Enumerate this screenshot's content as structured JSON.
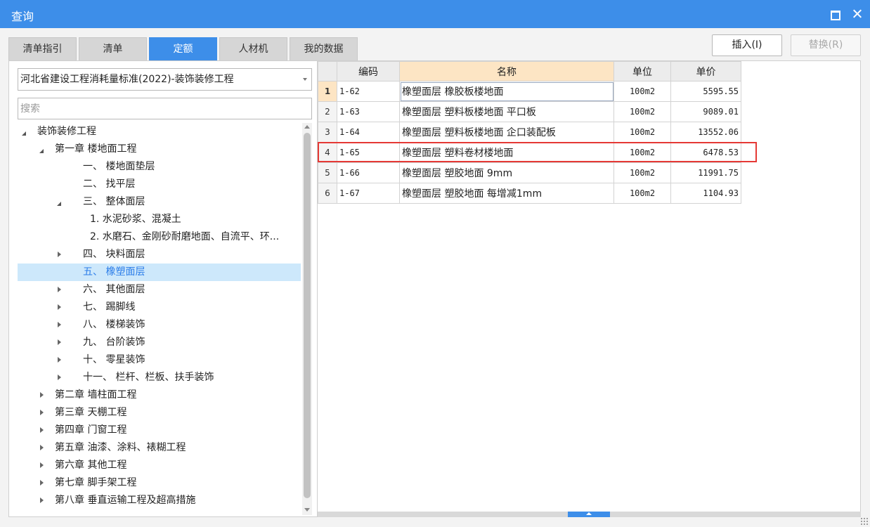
{
  "window": {
    "title": "查询"
  },
  "tabs": [
    "清单指引",
    "清单",
    "定额",
    "人材机",
    "我的数据"
  ],
  "active_tab": "定额",
  "actions": {
    "insert": "插入(I)",
    "replace": "替换(R)"
  },
  "library": {
    "selected": "河北省建设工程消耗量标准(2022)-装饰装修工程"
  },
  "search": {
    "placeholder": "搜索",
    "value": ""
  },
  "tree": [
    {
      "label": "装饰装修工程",
      "level": 0,
      "toggle": "open"
    },
    {
      "label": "第一章 楼地面工程",
      "level": 1,
      "toggle": "open"
    },
    {
      "label": "一、  楼地面垫层",
      "level": 2,
      "toggle": "none"
    },
    {
      "label": "二、  找平层",
      "level": 2,
      "toggle": "none"
    },
    {
      "label": "三、  整体面层",
      "level": 2,
      "toggle": "open"
    },
    {
      "label": "1. 水泥砂浆、混凝土",
      "level": 3,
      "toggle": "none"
    },
    {
      "label": "2. 水磨石、金刚砂耐磨地面、自流平、环...",
      "level": 3,
      "toggle": "none"
    },
    {
      "label": "四、  块料面层",
      "level": 2,
      "toggle": "closed"
    },
    {
      "label": "五、  橡塑面层",
      "level": 2,
      "toggle": "none",
      "selected": true
    },
    {
      "label": "六、  其他面层",
      "level": 2,
      "toggle": "closed"
    },
    {
      "label": "七、  踢脚线",
      "level": 2,
      "toggle": "closed"
    },
    {
      "label": "八、  楼梯装饰",
      "level": 2,
      "toggle": "closed"
    },
    {
      "label": "九、  台阶装饰",
      "level": 2,
      "toggle": "closed"
    },
    {
      "label": "十、  零星装饰",
      "level": 2,
      "toggle": "closed"
    },
    {
      "label": "十一、 栏杆、栏板、扶手装饰",
      "level": 2,
      "toggle": "closed"
    },
    {
      "label": "第二章 墙柱面工程",
      "level": 1,
      "toggle": "closed"
    },
    {
      "label": "第三章 天棚工程",
      "level": 1,
      "toggle": "closed"
    },
    {
      "label": "第四章 门窗工程",
      "level": 1,
      "toggle": "closed"
    },
    {
      "label": "第五章 油漆、涂料、裱糊工程",
      "level": 1,
      "toggle": "closed"
    },
    {
      "label": "第六章 其他工程",
      "level": 1,
      "toggle": "closed"
    },
    {
      "label": "第七章 脚手架工程",
      "level": 1,
      "toggle": "closed"
    },
    {
      "label": "第八章 垂直运输工程及超高措施",
      "level": 1,
      "toggle": "closed"
    }
  ],
  "table": {
    "headers": [
      "",
      "编码",
      "名称",
      "单位",
      "单价"
    ],
    "rows": [
      {
        "idx": "1",
        "code": "1-62",
        "name": "橡塑面层 橡胶板楼地面",
        "unit": "100m2",
        "price": "5595.55"
      },
      {
        "idx": "2",
        "code": "1-63",
        "name": "橡塑面层 塑料板楼地面 平口板",
        "unit": "100m2",
        "price": "9089.01"
      },
      {
        "idx": "3",
        "code": "1-64",
        "name": "橡塑面层 塑料板楼地面 企口装配板",
        "unit": "100m2",
        "price": "13552.06"
      },
      {
        "idx": "4",
        "code": "1-65",
        "name": "橡塑面层 塑料卷材楼地面",
        "unit": "100m2",
        "price": "6478.53"
      },
      {
        "idx": "5",
        "code": "1-66",
        "name": "橡塑面层 塑胶地面 9mm",
        "unit": "100m2",
        "price": "11991.75"
      },
      {
        "idx": "6",
        "code": "1-67",
        "name": "橡塑面层 塑胶地面 每增减1mm",
        "unit": "100m2",
        "price": "1104.93"
      }
    ],
    "current_row": "1",
    "highlighted_row": "4"
  },
  "colors": {
    "accent": "#3d8ee9",
    "highlight_box": "#e53935",
    "selected_header": "#fde5c4",
    "tree_selected": "#cde8fb"
  }
}
